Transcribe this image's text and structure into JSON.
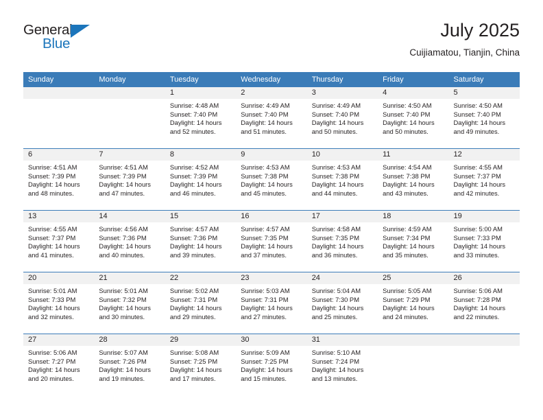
{
  "brand": {
    "word1": "General",
    "word2": "Blue",
    "triangle_color": "#1b75bb"
  },
  "header": {
    "title": "July 2025",
    "subtitle": "Cuijiamatou, Tianjin, China"
  },
  "theme": {
    "header_blue": "#3b7cb8",
    "daynum_gray": "#f1f1f1",
    "text": "#231f20"
  },
  "weekday_headers": [
    "Sunday",
    "Monday",
    "Tuesday",
    "Wednesday",
    "Thursday",
    "Friday",
    "Saturday"
  ],
  "weeks": [
    [
      {
        "day": "",
        "sunrise": "",
        "sunset": "",
        "daylight1": "",
        "daylight2": ""
      },
      {
        "day": "",
        "sunrise": "",
        "sunset": "",
        "daylight1": "",
        "daylight2": ""
      },
      {
        "day": "1",
        "sunrise": "Sunrise: 4:48 AM",
        "sunset": "Sunset: 7:40 PM",
        "daylight1": "Daylight: 14 hours",
        "daylight2": "and 52 minutes."
      },
      {
        "day": "2",
        "sunrise": "Sunrise: 4:49 AM",
        "sunset": "Sunset: 7:40 PM",
        "daylight1": "Daylight: 14 hours",
        "daylight2": "and 51 minutes."
      },
      {
        "day": "3",
        "sunrise": "Sunrise: 4:49 AM",
        "sunset": "Sunset: 7:40 PM",
        "daylight1": "Daylight: 14 hours",
        "daylight2": "and 50 minutes."
      },
      {
        "day": "4",
        "sunrise": "Sunrise: 4:50 AM",
        "sunset": "Sunset: 7:40 PM",
        "daylight1": "Daylight: 14 hours",
        "daylight2": "and 50 minutes."
      },
      {
        "day": "5",
        "sunrise": "Sunrise: 4:50 AM",
        "sunset": "Sunset: 7:40 PM",
        "daylight1": "Daylight: 14 hours",
        "daylight2": "and 49 minutes."
      }
    ],
    [
      {
        "day": "6",
        "sunrise": "Sunrise: 4:51 AM",
        "sunset": "Sunset: 7:39 PM",
        "daylight1": "Daylight: 14 hours",
        "daylight2": "and 48 minutes."
      },
      {
        "day": "7",
        "sunrise": "Sunrise: 4:51 AM",
        "sunset": "Sunset: 7:39 PM",
        "daylight1": "Daylight: 14 hours",
        "daylight2": "and 47 minutes."
      },
      {
        "day": "8",
        "sunrise": "Sunrise: 4:52 AM",
        "sunset": "Sunset: 7:39 PM",
        "daylight1": "Daylight: 14 hours",
        "daylight2": "and 46 minutes."
      },
      {
        "day": "9",
        "sunrise": "Sunrise: 4:53 AM",
        "sunset": "Sunset: 7:38 PM",
        "daylight1": "Daylight: 14 hours",
        "daylight2": "and 45 minutes."
      },
      {
        "day": "10",
        "sunrise": "Sunrise: 4:53 AM",
        "sunset": "Sunset: 7:38 PM",
        "daylight1": "Daylight: 14 hours",
        "daylight2": "and 44 minutes."
      },
      {
        "day": "11",
        "sunrise": "Sunrise: 4:54 AM",
        "sunset": "Sunset: 7:38 PM",
        "daylight1": "Daylight: 14 hours",
        "daylight2": "and 43 minutes."
      },
      {
        "day": "12",
        "sunrise": "Sunrise: 4:55 AM",
        "sunset": "Sunset: 7:37 PM",
        "daylight1": "Daylight: 14 hours",
        "daylight2": "and 42 minutes."
      }
    ],
    [
      {
        "day": "13",
        "sunrise": "Sunrise: 4:55 AM",
        "sunset": "Sunset: 7:37 PM",
        "daylight1": "Daylight: 14 hours",
        "daylight2": "and 41 minutes."
      },
      {
        "day": "14",
        "sunrise": "Sunrise: 4:56 AM",
        "sunset": "Sunset: 7:36 PM",
        "daylight1": "Daylight: 14 hours",
        "daylight2": "and 40 minutes."
      },
      {
        "day": "15",
        "sunrise": "Sunrise: 4:57 AM",
        "sunset": "Sunset: 7:36 PM",
        "daylight1": "Daylight: 14 hours",
        "daylight2": "and 39 minutes."
      },
      {
        "day": "16",
        "sunrise": "Sunrise: 4:57 AM",
        "sunset": "Sunset: 7:35 PM",
        "daylight1": "Daylight: 14 hours",
        "daylight2": "and 37 minutes."
      },
      {
        "day": "17",
        "sunrise": "Sunrise: 4:58 AM",
        "sunset": "Sunset: 7:35 PM",
        "daylight1": "Daylight: 14 hours",
        "daylight2": "and 36 minutes."
      },
      {
        "day": "18",
        "sunrise": "Sunrise: 4:59 AM",
        "sunset": "Sunset: 7:34 PM",
        "daylight1": "Daylight: 14 hours",
        "daylight2": "and 35 minutes."
      },
      {
        "day": "19",
        "sunrise": "Sunrise: 5:00 AM",
        "sunset": "Sunset: 7:33 PM",
        "daylight1": "Daylight: 14 hours",
        "daylight2": "and 33 minutes."
      }
    ],
    [
      {
        "day": "20",
        "sunrise": "Sunrise: 5:01 AM",
        "sunset": "Sunset: 7:33 PM",
        "daylight1": "Daylight: 14 hours",
        "daylight2": "and 32 minutes."
      },
      {
        "day": "21",
        "sunrise": "Sunrise: 5:01 AM",
        "sunset": "Sunset: 7:32 PM",
        "daylight1": "Daylight: 14 hours",
        "daylight2": "and 30 minutes."
      },
      {
        "day": "22",
        "sunrise": "Sunrise: 5:02 AM",
        "sunset": "Sunset: 7:31 PM",
        "daylight1": "Daylight: 14 hours",
        "daylight2": "and 29 minutes."
      },
      {
        "day": "23",
        "sunrise": "Sunrise: 5:03 AM",
        "sunset": "Sunset: 7:31 PM",
        "daylight1": "Daylight: 14 hours",
        "daylight2": "and 27 minutes."
      },
      {
        "day": "24",
        "sunrise": "Sunrise: 5:04 AM",
        "sunset": "Sunset: 7:30 PM",
        "daylight1": "Daylight: 14 hours",
        "daylight2": "and 25 minutes."
      },
      {
        "day": "25",
        "sunrise": "Sunrise: 5:05 AM",
        "sunset": "Sunset: 7:29 PM",
        "daylight1": "Daylight: 14 hours",
        "daylight2": "and 24 minutes."
      },
      {
        "day": "26",
        "sunrise": "Sunrise: 5:06 AM",
        "sunset": "Sunset: 7:28 PM",
        "daylight1": "Daylight: 14 hours",
        "daylight2": "and 22 minutes."
      }
    ],
    [
      {
        "day": "27",
        "sunrise": "Sunrise: 5:06 AM",
        "sunset": "Sunset: 7:27 PM",
        "daylight1": "Daylight: 14 hours",
        "daylight2": "and 20 minutes."
      },
      {
        "day": "28",
        "sunrise": "Sunrise: 5:07 AM",
        "sunset": "Sunset: 7:26 PM",
        "daylight1": "Daylight: 14 hours",
        "daylight2": "and 19 minutes."
      },
      {
        "day": "29",
        "sunrise": "Sunrise: 5:08 AM",
        "sunset": "Sunset: 7:25 PM",
        "daylight1": "Daylight: 14 hours",
        "daylight2": "and 17 minutes."
      },
      {
        "day": "30",
        "sunrise": "Sunrise: 5:09 AM",
        "sunset": "Sunset: 7:25 PM",
        "daylight1": "Daylight: 14 hours",
        "daylight2": "and 15 minutes."
      },
      {
        "day": "31",
        "sunrise": "Sunrise: 5:10 AM",
        "sunset": "Sunset: 7:24 PM",
        "daylight1": "Daylight: 14 hours",
        "daylight2": "and 13 minutes."
      },
      {
        "day": "",
        "sunrise": "",
        "sunset": "",
        "daylight1": "",
        "daylight2": ""
      },
      {
        "day": "",
        "sunrise": "",
        "sunset": "",
        "daylight1": "",
        "daylight2": ""
      }
    ]
  ]
}
